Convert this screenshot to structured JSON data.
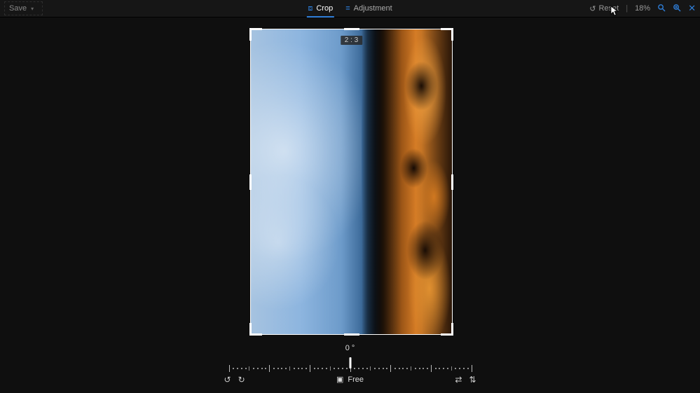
{
  "toolbar": {
    "save_label": "Save",
    "tabs": [
      {
        "label": "Crop",
        "icon": "crop-icon",
        "active": true
      },
      {
        "label": "Adjustment",
        "icon": "adjustment-icon",
        "active": false
      }
    ],
    "reset_label": "Reset",
    "zoom_level": "18%"
  },
  "crop": {
    "aspect_ratio_badge": "2 : 3",
    "rotation_angle": "0 °",
    "ratio_mode_label": "Free"
  },
  "icons": {
    "rotate_ccw": "↺",
    "rotate_cw": "↻",
    "flip_h": "⇄",
    "flip_v": "⇅",
    "zoom_fit": "⤢",
    "zoom_out": "−",
    "zoom_in": "+",
    "close": "✕",
    "undo_reset": "↺",
    "aspect_box": "▣"
  }
}
